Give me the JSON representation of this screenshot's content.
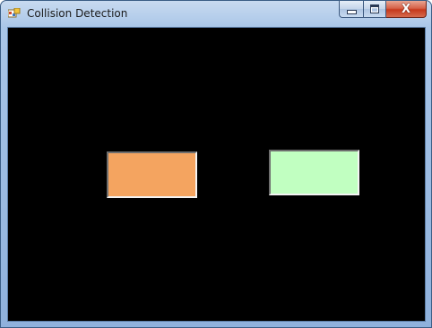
{
  "window": {
    "title": "Collision Detection",
    "icon": "app-window-icon",
    "caption_buttons": {
      "minimize_icon": "minimize-icon",
      "maximize_icon": "maximize-icon",
      "close_icon": "close-icon",
      "close_glyph": "X"
    }
  },
  "canvas": {
    "background": "#000000",
    "blocks": [
      {
        "name": "left-block",
        "color": "#f4a460"
      },
      {
        "name": "right-block",
        "color": "#c1ffc1"
      }
    ]
  }
}
